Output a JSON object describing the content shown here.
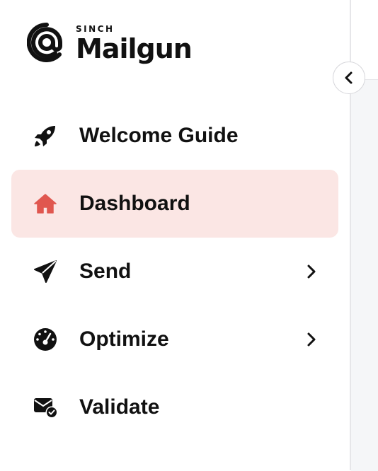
{
  "brand": {
    "sub": "SINCH",
    "name": "Mailgun"
  },
  "collapse_button": {
    "icon": "chevron-left-icon"
  },
  "nav": [
    {
      "label": "Welcome Guide",
      "icon": "rocket-icon",
      "active": false,
      "has_submenu": false
    },
    {
      "label": "Dashboard",
      "icon": "home-icon",
      "active": true,
      "has_submenu": false
    },
    {
      "label": "Send",
      "icon": "paper-plane-icon",
      "active": false,
      "has_submenu": true
    },
    {
      "label": "Optimize",
      "icon": "gauge-icon",
      "active": false,
      "has_submenu": true
    },
    {
      "label": "Validate",
      "icon": "mail-check-icon",
      "active": false,
      "has_submenu": false
    }
  ],
  "colors": {
    "active_bg": "#fbe6e4",
    "active_icon": "#e0574f",
    "text": "#111111"
  }
}
